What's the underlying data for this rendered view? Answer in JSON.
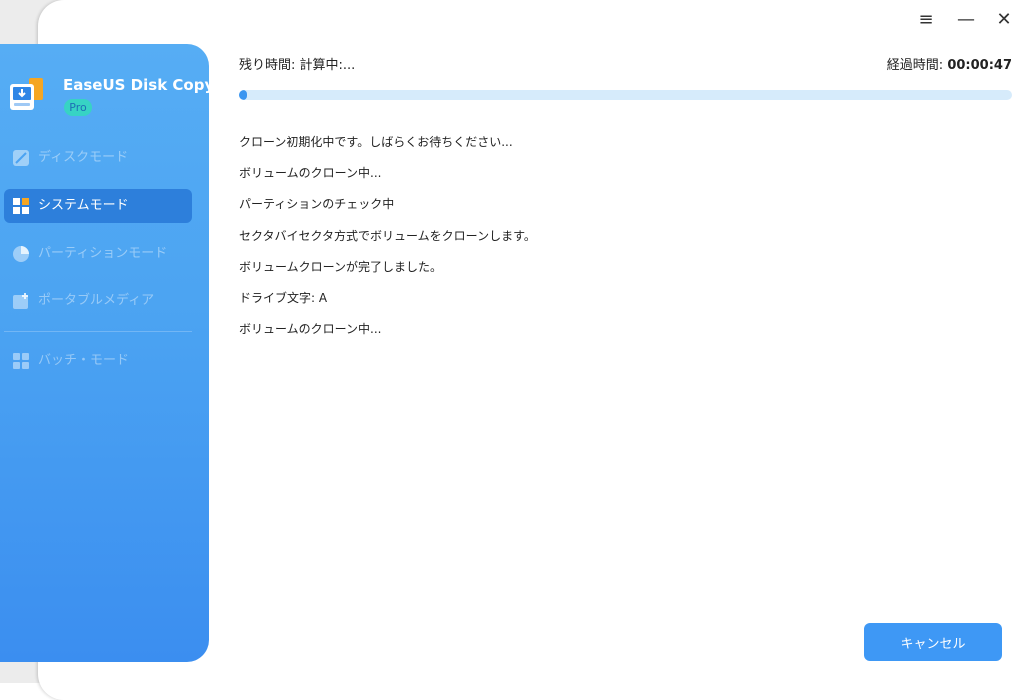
{
  "app": {
    "name": "EaseUS Disk Copy",
    "badge": "Pro"
  },
  "window_controls": {
    "menu_icon": "menu-icon",
    "minimize_icon": "minimize-icon",
    "close_icon": "close-icon"
  },
  "sidebar": {
    "items": [
      {
        "label": "ディスクモード",
        "icon": "disk-icon",
        "state": "disabled"
      },
      {
        "label": "システムモード",
        "icon": "windows-icon",
        "state": "active"
      },
      {
        "label": "パーティションモード",
        "icon": "pie-icon",
        "state": "disabled"
      },
      {
        "label": "ポータブルメディア",
        "icon": "portable-media-icon",
        "state": "disabled"
      },
      {
        "label": "バッチ・モード",
        "icon": "grid-icon",
        "state": "disabled"
      }
    ]
  },
  "status": {
    "remaining_label": "残り時間: 計算中:...",
    "elapsed_label": "経過時間:",
    "elapsed_value": "00:00:47",
    "progress": 0.01
  },
  "log": [
    "クローン初期化中です。しばらくお待ちください...",
    "ボリュームのクローン中...",
    "パーティションのチェック中",
    "セクタバイセクタ方式でボリュームをクローンします。",
    "ボリュームクローンが完了しました。",
    "ドライブ文字: A",
    "ボリュームのクローン中..."
  ],
  "actions": {
    "cancel_label": "キャンセル"
  },
  "colors": {
    "sidebar": "#4ba3f2",
    "active_item": "#2d7fdb",
    "accent": "#3e98f5",
    "progress_track": "#d6ebfb",
    "pro_badge": "#37d3c4"
  }
}
